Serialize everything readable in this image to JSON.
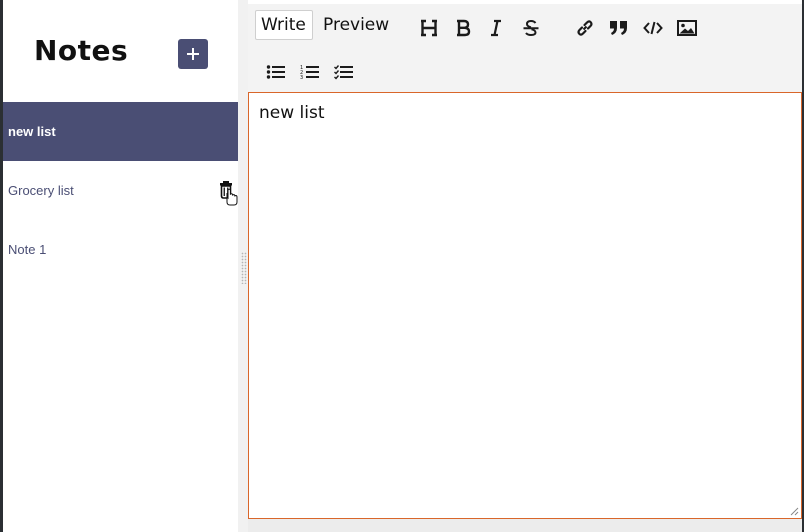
{
  "sidebar": {
    "title": "Notes",
    "add_button_icon": "plus-icon",
    "notes": [
      {
        "label": "new list",
        "active": true
      },
      {
        "label": "Grocery list",
        "active": false
      },
      {
        "label": "Note 1",
        "active": false
      }
    ]
  },
  "editor": {
    "tabs": {
      "write": "Write",
      "preview": "Preview"
    },
    "active_tab": "Write",
    "toolbar_icons": [
      "heading-icon",
      "bold-icon",
      "italic-icon",
      "strikethrough-icon",
      "link-icon",
      "quote-icon",
      "code-icon",
      "image-icon",
      "unordered-list-icon",
      "ordered-list-icon",
      "checklist-icon"
    ],
    "content": "new list"
  },
  "colors": {
    "accent": "#4a4e74",
    "editor_border": "#d9662a",
    "toolbar_bg": "#f3f3f3"
  }
}
